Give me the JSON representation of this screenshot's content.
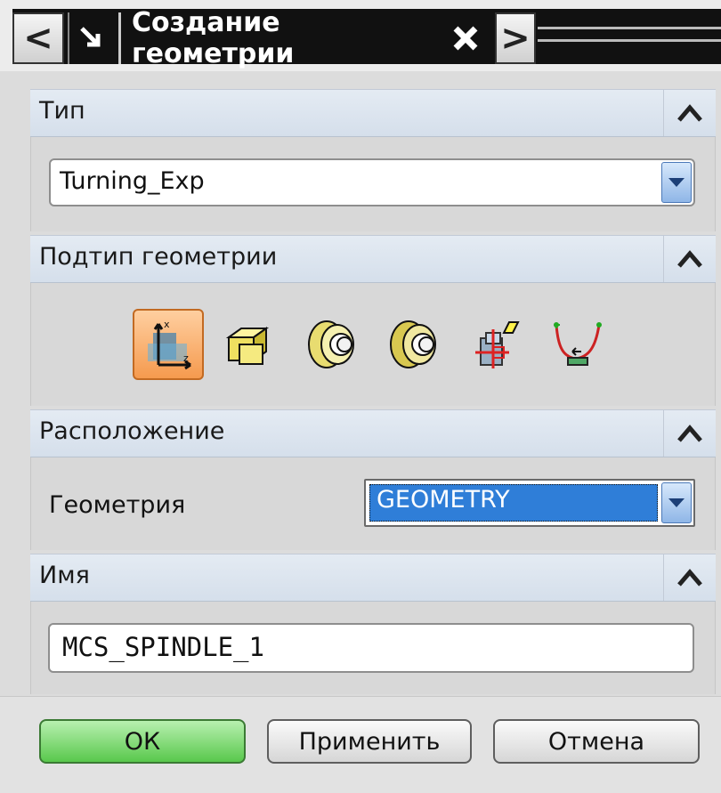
{
  "title_bar": {
    "back_label": "<",
    "pin_label": "↘",
    "title": "Создание геометрии",
    "close_label": "✕",
    "forward_label": ">"
  },
  "sections": {
    "type": {
      "header": "Тип",
      "selected": "Turning_Exp"
    },
    "subtype": {
      "header": "Подтип геометрии",
      "icons": [
        "mcs-spindle-icon",
        "workpiece-icon",
        "turning-part-icon",
        "turning-workpiece-icon",
        "avoidance-icon",
        "containment-icon"
      ]
    },
    "location": {
      "header": "Расположение",
      "geometry_label": "Геометрия",
      "geometry_value": "GEOMETRY"
    },
    "name": {
      "header": "Имя",
      "value": "MCS_SPINDLE_1"
    }
  },
  "buttons": {
    "ok": "ОК",
    "apply": "Применить",
    "cancel": "Отмена"
  },
  "colors": {
    "header_bg": "#dde5ef",
    "selection": "#2f7ed8",
    "ok_green": "#59c84c",
    "active_icon": "#f59a4e"
  }
}
